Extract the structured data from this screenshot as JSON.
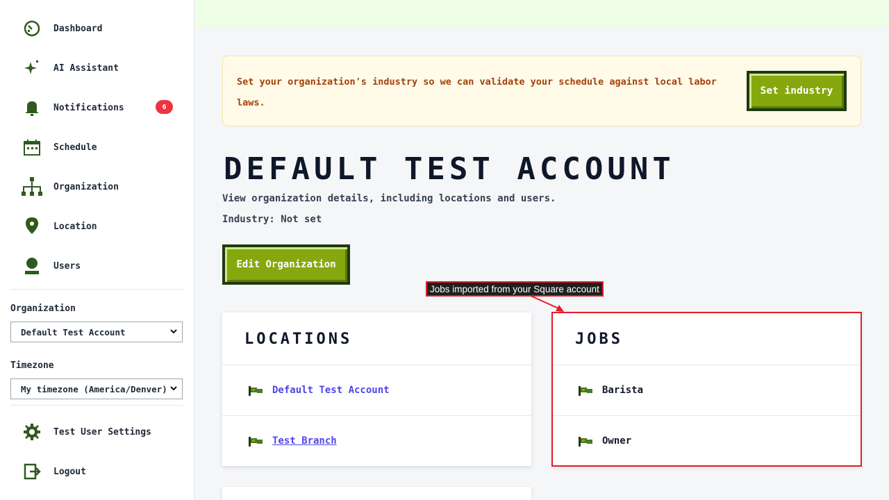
{
  "sidebar": {
    "items": [
      {
        "label": "Dashboard",
        "icon": "dashboard-icon"
      },
      {
        "label": "AI Assistant",
        "icon": "sparkle-icon"
      },
      {
        "label": "Notifications",
        "icon": "bell-icon",
        "badge": "6"
      },
      {
        "label": "Schedule",
        "icon": "calendar-icon"
      },
      {
        "label": "Organization",
        "icon": "org-chart-icon"
      },
      {
        "label": "Location",
        "icon": "map-pin-icon"
      },
      {
        "label": "Users",
        "icon": "user-icon"
      }
    ],
    "organization_label": "Organization",
    "organization_value": "Default Test Account",
    "timezone_label": "Timezone",
    "timezone_value": "My timezone (America/Denver)",
    "settings_label": "Test User Settings",
    "logout_label": "Logout"
  },
  "alert": {
    "text": "Set your organization's industry so we can validate your schedule against local labor laws.",
    "button_label": "Set industry"
  },
  "page": {
    "title": "DEFAULT TEST ACCOUNT",
    "description": "View organization details, including locations and users.",
    "industry": "Industry: Not set",
    "edit_button": "Edit Organization"
  },
  "locations": {
    "title": "LOCATIONS",
    "items": [
      "Default Test Account",
      "Test Branch"
    ]
  },
  "jobs": {
    "title": "JOBS",
    "items": [
      "Barista",
      "Owner"
    ]
  },
  "annotation": {
    "text": "Jobs imported from your Square account"
  },
  "colors": {
    "accent": "#86a80f",
    "dark_green": "#1e3a0f",
    "badge": "#ef3340",
    "link": "#4f46e5",
    "annotation": "#e11d2a"
  }
}
